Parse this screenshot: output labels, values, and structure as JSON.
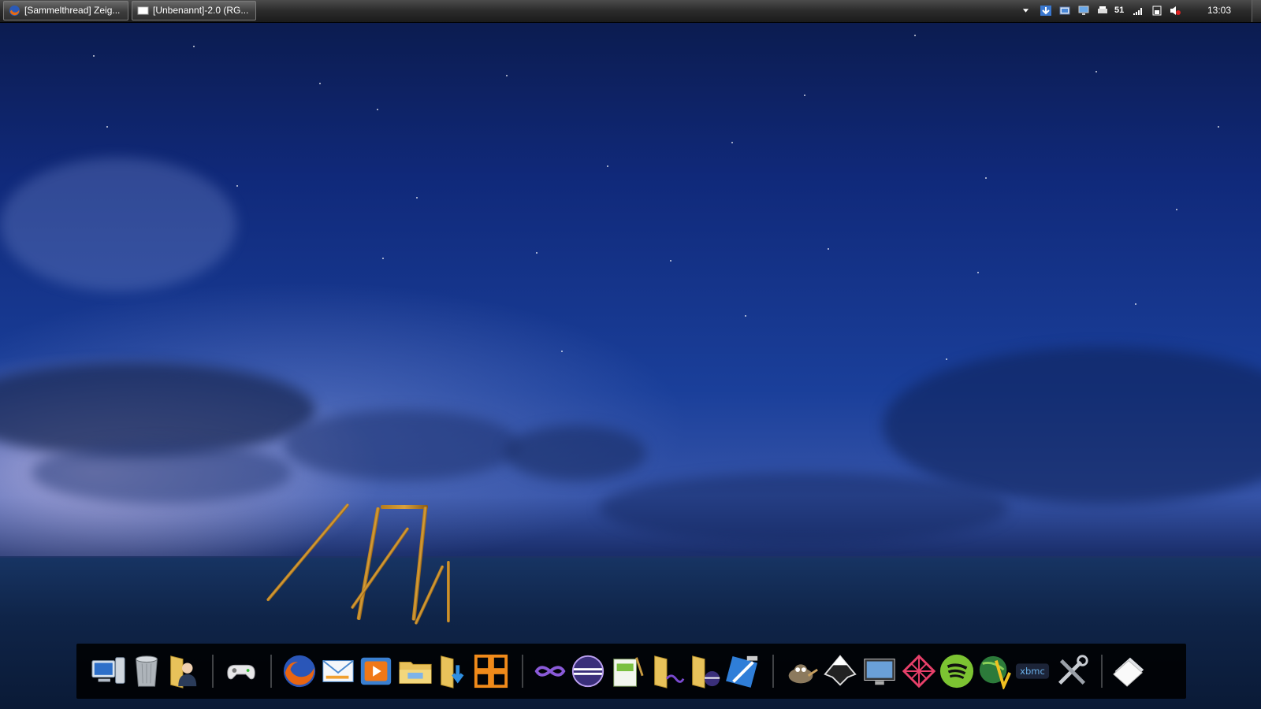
{
  "taskbar": {
    "tasks": [
      {
        "label": "[Sammelthread] Zeig...",
        "icon": "firefox-icon"
      },
      {
        "label": "[Unbenannt]-2.0 (RG...",
        "icon": "gimp-window-icon"
      }
    ],
    "tray": {
      "battery_percent": "51",
      "clock": "13:03",
      "icons": [
        "tray-overflow-arrow-icon",
        "download-icon",
        "network-icon",
        "monitor-icon",
        "printer-icon",
        "signal-icon",
        "battery-icon",
        "mute-icon"
      ]
    }
  },
  "dock": {
    "items": [
      "computer-icon",
      "trash-icon",
      "user-folder-icon",
      "gamepad-icon",
      "firefox-icon",
      "mail-icon",
      "media-player-icon",
      "explorer-folder-icon",
      "downloads-folder-icon",
      "office-icon",
      "visual-studio-icon",
      "eclipse-icon",
      "notepad-icon",
      "vs-folder-icon",
      "eclipse-folder-icon",
      "xcode-tools-icon",
      "gimp-icon",
      "inkscape-icon",
      "display-icon",
      "zune-icon",
      "spotify-icon",
      "vuze-icon",
      "xbmc-icon",
      "settings-tools-icon",
      "papers-icon"
    ]
  }
}
